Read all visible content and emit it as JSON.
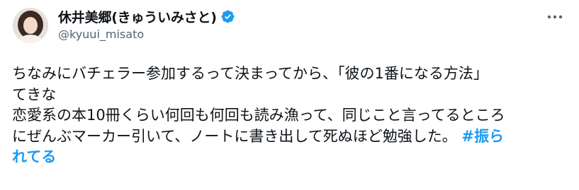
{
  "author": {
    "display_name": "休井美郷(きゅういみさと)",
    "handle": "@kyuui_misato",
    "verified_color": "#1d9bf0"
  },
  "post": {
    "lines": [
      "ちなみにバチェラー参加するって決まってから、「彼の1番になる方法」",
      "てきな",
      "恋愛系の本10冊くらい何回も何回も読み漁って、同じこと言ってるところ",
      "にぜんぶマーカー引いて、ノートに書き出して死ぬほど勉強した。 "
    ],
    "hashtag_part1": "#振ら",
    "hashtag_part2": "れてる"
  },
  "icons": {
    "more": "more-horizontal-icon",
    "verified": "verified-badge-icon"
  }
}
